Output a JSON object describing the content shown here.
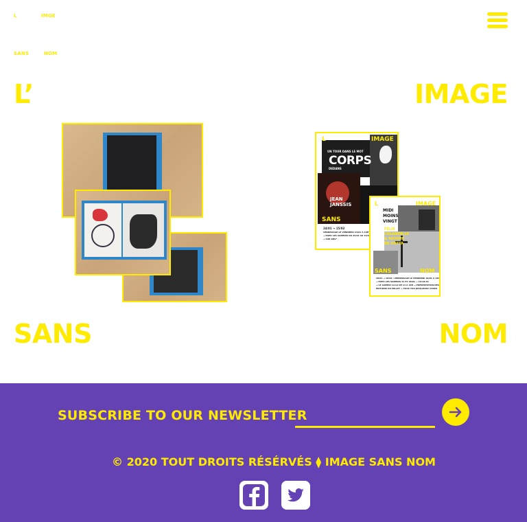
{
  "header": {
    "logo_top_left": "L",
    "logo_top_right": "IMGE",
    "logo_bottom_left": "SANS",
    "logo_bottom_right": "NOM",
    "menu_icon": "hamburger-menu-icon"
  },
  "hero": {
    "word_1": "L’",
    "word_2": "IMAGE",
    "word_3": "SANS",
    "word_4": "NOM"
  },
  "poster_1": {
    "corner_left": "L",
    "corner_right": "IMAGE",
    "subtitle": "UN TOUR DANS LE MOT",
    "title": "CORPS",
    "artist_label": "DEDANS",
    "artist": "JEAN JANSSIS",
    "footer_word": "SANS",
    "dates": "24/01 → 15/02",
    "line_1": "VERNISSAGE LE VENDREDI 24/01 À 18H",
    "line_2": "→ EXPO LES SAMEDIS DU 25/01 AU 15/02",
    "line_3": "→ SUR RDV*"
  },
  "poster_2": {
    "corner_left": "L",
    "corner_right": "IMAGE",
    "title": "MIDI MOINS VINGT",
    "artist": "FÉLIX COLARDELLE & MAXIME DE GOTTA",
    "footer_left": "SANS",
    "footer_right": "NOM",
    "line_1": "20/01 → 18/02 / VERNISSAGE LE VENDREDI 20/01 À 18H",
    "line_2": "→ EXPO LES SAMEDIS 21 ET 28/01 → 10:19:30",
    "line_3": "→ LE SAMEDI 11/12 DE 14 À 18H → PRÉSENTATION DES",
    "line_4": "ÉDITIONS DU MILLET + PUCK YOU JEAN-MARC CHAPA"
  },
  "newsletter": {
    "label": "SUBSCRIBE TO OUR NEWSLETTER",
    "placeholder": "",
    "button_icon": "arrow-right-icon"
  },
  "footer": {
    "copyright": "© 2020 TOUT DROITS RÉSÉRVÉS ⧫ IMAGE SANS NOM",
    "social": [
      "facebook-icon",
      "twitter-icon"
    ]
  },
  "colors": {
    "accent": "#ffeb00",
    "footer_bg": "#6442b4",
    "tape_blue": "#2f86c9"
  }
}
